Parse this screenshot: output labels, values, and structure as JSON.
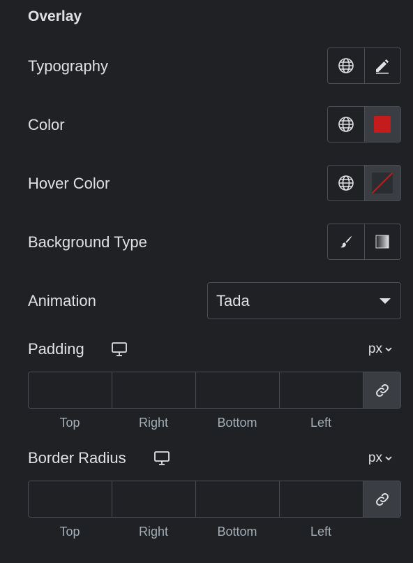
{
  "section": {
    "title": "Overlay"
  },
  "rows": {
    "typography": {
      "label": "Typography"
    },
    "color": {
      "label": "Color",
      "value": "#c41c1c"
    },
    "hover_color": {
      "label": "Hover Color"
    },
    "background_type": {
      "label": "Background Type"
    },
    "animation": {
      "label": "Animation",
      "value": "Tada"
    }
  },
  "padding": {
    "label": "Padding",
    "unit": "px",
    "fields": [
      "Top",
      "Right",
      "Bottom",
      "Left"
    ]
  },
  "border_radius": {
    "label": "Border Radius",
    "unit": "px",
    "fields": [
      "Top",
      "Right",
      "Bottom",
      "Left"
    ]
  },
  "icons": [
    "globe-icon",
    "pencil-icon",
    "brush-icon",
    "gradient-icon",
    "desktop-icon",
    "link-icon",
    "chevron-down-icon"
  ],
  "colors": {
    "background": "#1f2124",
    "text": "#e0e1e3",
    "border": "#4a4e54",
    "muted": "#a4afb7",
    "active_cell": "#3a3d42",
    "swatch": "#c41c1c"
  }
}
